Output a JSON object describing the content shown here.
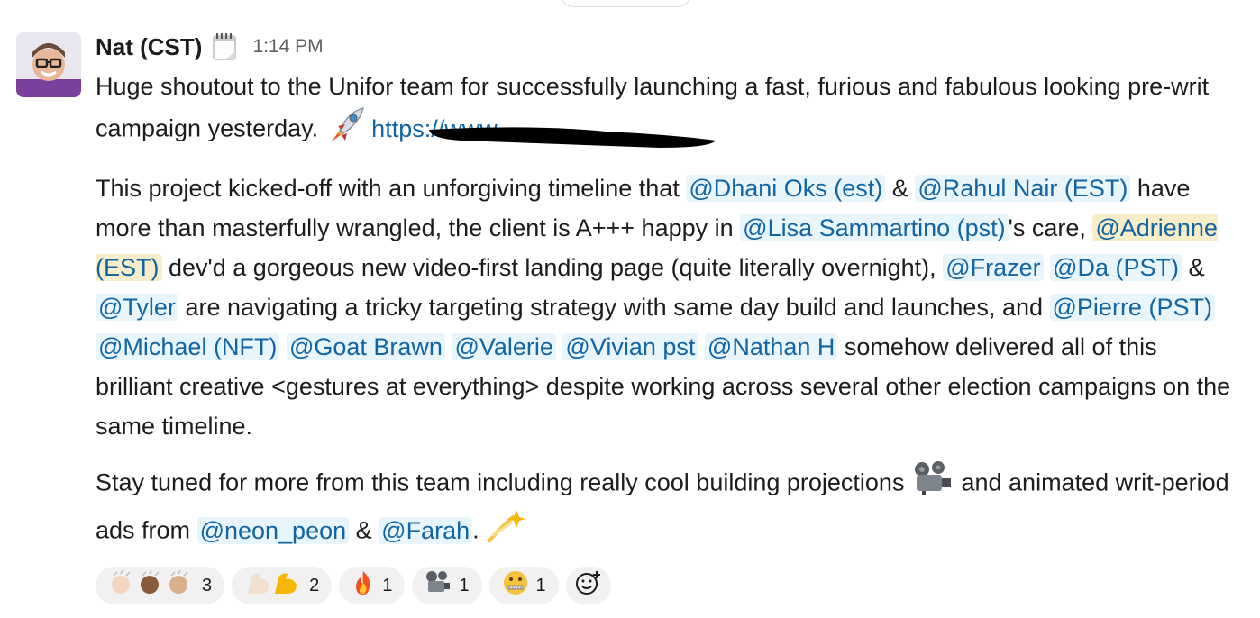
{
  "message": {
    "author": "Nat (CST)",
    "time": "1:14 PM",
    "p1": {
      "text_a": "Huge shoutout to the Unifor team for successfully launching a fast, furious and fabulous looking pre-writ campaign yesterday.",
      "link": "https://www."
    },
    "p2": {
      "t1": "This project kicked-off with an unforgiving timeline that",
      "m1": "@Dhani Oks (est)",
      "t2": "&",
      "m2": "@Rahul Nair (EST)",
      "t3": "have more than masterfully wrangled, the client is A+++ happy in",
      "m3": "@Lisa Sammartino (pst)",
      "t4": "'s care,",
      "m4": "@Adrienne (EST)",
      "t5": "dev'd a gorgeous new video-first landing page (quite literally overnight),",
      "m5": "@Frazer",
      "m6": "@Da (PST)",
      "t6": "&",
      "m7": "@Tyler",
      "t7": "are navigating a tricky targeting strategy with same day build and launches, and",
      "m8": "@Pierre (PST)",
      "m9": "@Michael (NFT)",
      "m10": "@Goat Brawn",
      "m11": "@Valerie",
      "m12": "@Vivian pst",
      "m13": "@Nathan H",
      "t8": "somehow delivered all of this brilliant creative <gestures at everything> despite working across several other election campaigns on the same timeline."
    },
    "p3": {
      "t1": "Stay tuned for more from this team including really cool building projections",
      "t2": "and animated writ-period ads from",
      "m1": "@neon_peon",
      "t3": "&",
      "m2": "@Farah",
      "t4": "."
    }
  },
  "reactions": [
    {
      "icon": "clap-icon",
      "count": "3"
    },
    {
      "icon": "flexed-biceps-icon",
      "count": "2"
    },
    {
      "icon": "fire-icon",
      "count": "1"
    },
    {
      "icon": "film-projector-icon",
      "count": "1"
    },
    {
      "icon": "zipper-mouth-face-icon",
      "count": "1"
    }
  ],
  "colors": {
    "mention": "#1264a3",
    "mention_bg": "#e8f5fa",
    "self_mention_bg": "#f8edc9",
    "reaction_bg": "#f1f1f1"
  }
}
